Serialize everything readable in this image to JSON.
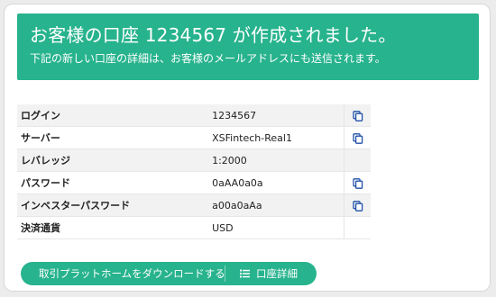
{
  "banner": {
    "title": "お客様の口座 1234567 が作成されました。",
    "subtitle": "下記の新しい口座の詳細は、お客様のメールアドレスにも送信されます。"
  },
  "account_rows": [
    {
      "label": "ログイン",
      "value": "1234567",
      "copyable": true
    },
    {
      "label": "サーバー",
      "value": "XSFintech-Real1",
      "copyable": true
    },
    {
      "label": "レバレッジ",
      "value": "1:2000",
      "copyable": false
    },
    {
      "label": "パスワード",
      "value": "0aAA0a0a",
      "copyable": true
    },
    {
      "label": "インベスターパスワード",
      "value": "a00a0aAa",
      "copyable": true
    },
    {
      "label": "決済通貨",
      "value": "USD",
      "copyable": false
    }
  ],
  "actions": {
    "download_label": "取引プラットホームをダウンロードする",
    "details_label": "口座詳細"
  },
  "icons": {
    "copy": "copy-icon",
    "download": "download-icon",
    "list": "list-icon"
  },
  "colors": {
    "accent": "#27b38d",
    "copy_icon": "#1f4fa8"
  }
}
